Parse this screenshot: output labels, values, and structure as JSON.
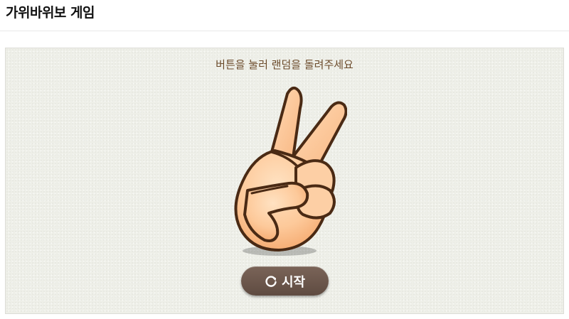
{
  "page": {
    "title": "가위바위보 게임"
  },
  "game": {
    "instruction": "버튼을 눌러 랜덤을 돌려주세요",
    "current_hand_icon": "scissors-hand-icon",
    "start_button": {
      "label": "시작",
      "icon": "refresh-icon"
    }
  },
  "colors": {
    "panel_background": "#eeefe8",
    "text_brown": "#6b4a2a",
    "button_brown": "#6b554a",
    "skin": "#fcc796",
    "outline": "#4a2a14"
  }
}
